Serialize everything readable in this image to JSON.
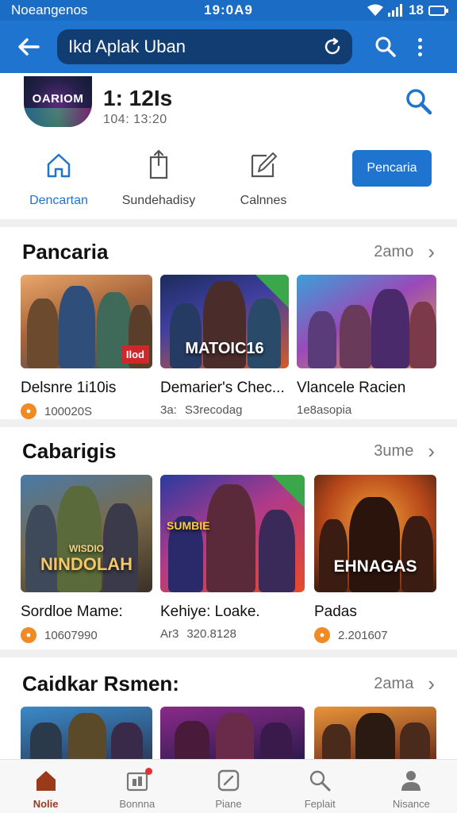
{
  "status_bar": {
    "carrier": "Noeangenos",
    "time": "19:0A9",
    "battery": "18"
  },
  "app_bar": {
    "search_value": "Ikd Aplak Uban"
  },
  "header": {
    "icon_text": "OARIOM",
    "title": "1: 12Is",
    "subtitle": "104: 13:20"
  },
  "quick_actions": {
    "items": [
      {
        "label": "Dencartan",
        "icon": "home-icon"
      },
      {
        "label": "Sundehadisy",
        "icon": "share-icon"
      },
      {
        "label": "Calnnes",
        "icon": "edit-icon"
      }
    ],
    "primary_button": "Pencaria"
  },
  "sections": [
    {
      "title": "Pancaria",
      "more": "2amo",
      "cards": [
        {
          "name": "Delsnre 1i10is",
          "meta": "100020S",
          "badge": "Ilod"
        },
        {
          "name": "Demarier's Chec...",
          "meta_prefix": "3a:",
          "meta": "S3recodag",
          "thumb_text": "MATOIC16"
        },
        {
          "name": "Vlancele Racien",
          "meta": "1e8asopia"
        }
      ]
    },
    {
      "title": "Cabarigis",
      "more": "3ume",
      "cards": [
        {
          "name": "Sordloe Mame:",
          "meta": "10607990",
          "thumb_text": "NINDOLAH",
          "thumb_top": "WISDIO"
        },
        {
          "name": "Kehiye: Loake.",
          "meta_prefix": "Ar3",
          "meta": "320.8128",
          "thumb_text": "SUMBIE"
        },
        {
          "name": "Padas",
          "meta": "2.201607",
          "thumb_text": "EHNAGAS"
        }
      ]
    },
    {
      "title": "Caidkar Rsmen:",
      "more": "2ama"
    }
  ],
  "bottom_nav": [
    {
      "label": "Nolie",
      "icon": "home-icon"
    },
    {
      "label": "Bonnna",
      "icon": "inbox-icon"
    },
    {
      "label": "Piane",
      "icon": "compass-icon"
    },
    {
      "label": "Feplait",
      "icon": "search-icon"
    },
    {
      "label": "Nisance",
      "icon": "profile-icon"
    }
  ],
  "colors": {
    "primary": "#1f74cf",
    "search_bg": "#123d72",
    "accent_orange": "#f08a24",
    "active_nav": "#9a3a1a"
  }
}
